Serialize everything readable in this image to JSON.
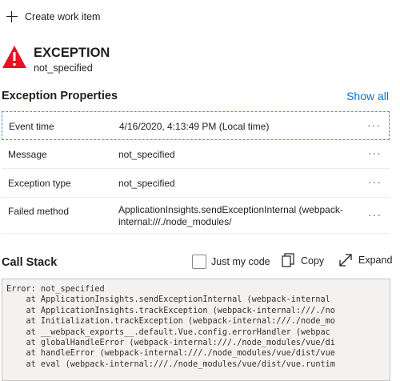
{
  "toolbar": {
    "create_label": "Create work item"
  },
  "exception": {
    "title": "EXCEPTION",
    "subtitle": "not_specified",
    "icon": "warning-icon",
    "icon_color": "#e81123"
  },
  "properties": {
    "title": "Exception Properties",
    "show_all": "Show all",
    "rows": [
      {
        "name": "Event time",
        "value": "4/16/2020, 4:13:49 PM (Local time)"
      },
      {
        "name": "Message",
        "value": "not_specified"
      },
      {
        "name": "Exception type",
        "value": "not_specified"
      },
      {
        "name": "Failed method",
        "value": "ApplicationInsights.sendExceptionInternal (webpack-internal:///./node_modules/"
      }
    ],
    "more": "···"
  },
  "call_stack": {
    "title": "Call Stack",
    "just_my_code": "Just my code",
    "copy": "Copy",
    "expand": "Expand",
    "lines": [
      "Error: not_specified",
      "    at ApplicationInsights.sendExceptionInternal (webpack-internal",
      "    at ApplicationInsights.trackException (webpack-internal:///./no",
      "    at Initialization.trackException (webpack-internal:///./node_mo",
      "    at __webpack_exports__.default.Vue.config.errorHandler (webpac",
      "    at globalHandleError (webpack-internal:///./node_modules/vue/di",
      "    at handleError (webpack-internal:///./node_modules/vue/dist/vue",
      "    at eval (webpack-internal:///./node_modules/vue/dist/vue.runtim"
    ]
  },
  "colors": {
    "accent": "#0078d4",
    "error": "#e81123",
    "focus_border": "#3a96dd"
  }
}
